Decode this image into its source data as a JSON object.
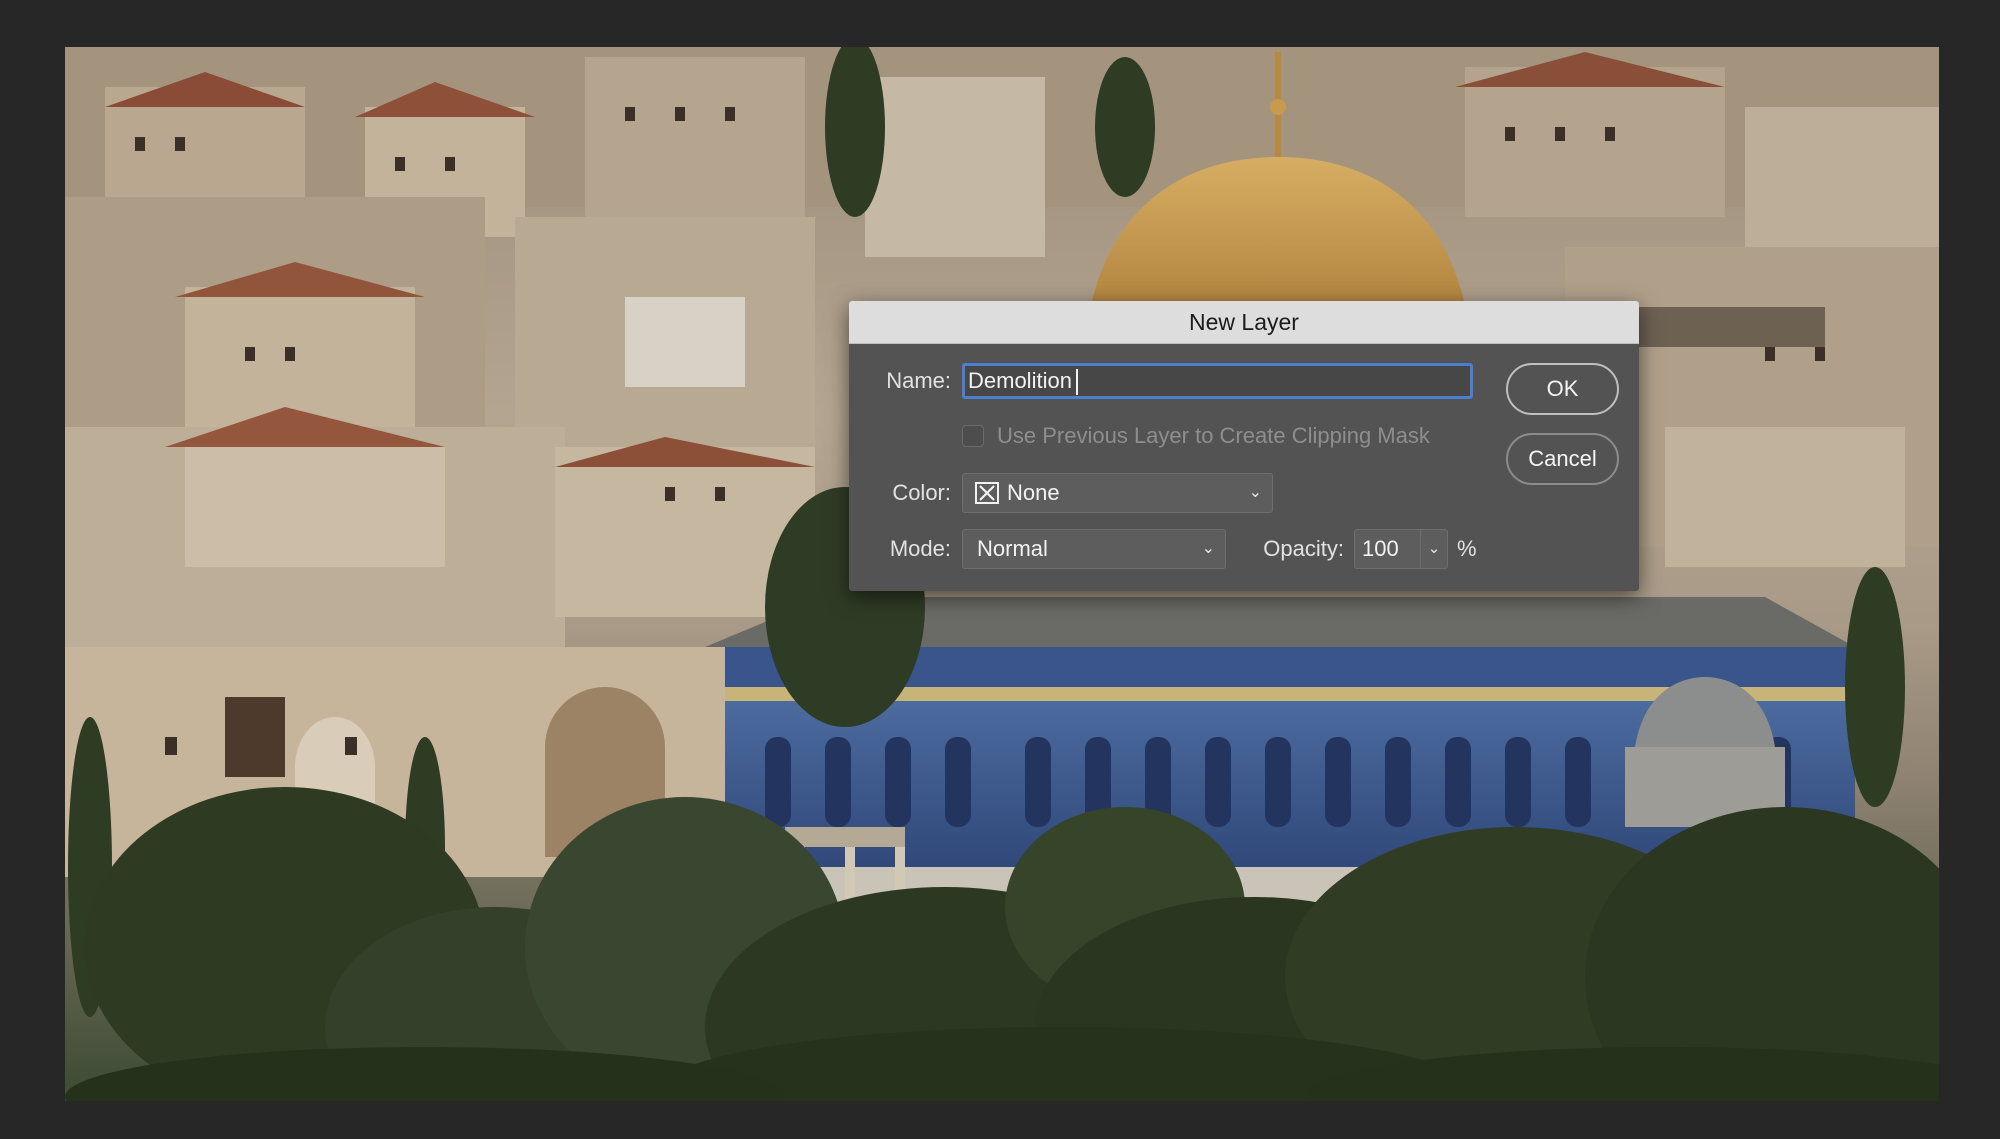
{
  "dialog": {
    "title": "New Layer",
    "name_label": "Name:",
    "name_value": "Demolition",
    "clipping_mask_label": "Use Previous Layer to Create Clipping Mask",
    "clipping_mask_checked": false,
    "clipping_mask_enabled": false,
    "color_label": "Color:",
    "color_value": "None",
    "mode_label": "Mode:",
    "mode_value": "Normal",
    "opacity_label": "Opacity:",
    "opacity_value": "100",
    "opacity_unit": "%",
    "ok_label": "OK",
    "cancel_label": "Cancel"
  },
  "icons": {
    "color_swatch": "x-mark-icon",
    "color_dropdown": "chevron-down-icon",
    "mode_dropdown": "chevron-down-icon",
    "opacity_dropdown": "chevron-down-icon"
  },
  "colors": {
    "background": "#272727",
    "dialog_body": "#535353",
    "dialog_titlebar": "#dddddd",
    "focus_ring": "#4a7fd1",
    "dome_gold": "#c99a4e",
    "tile_blue": "#3f5a8c"
  }
}
